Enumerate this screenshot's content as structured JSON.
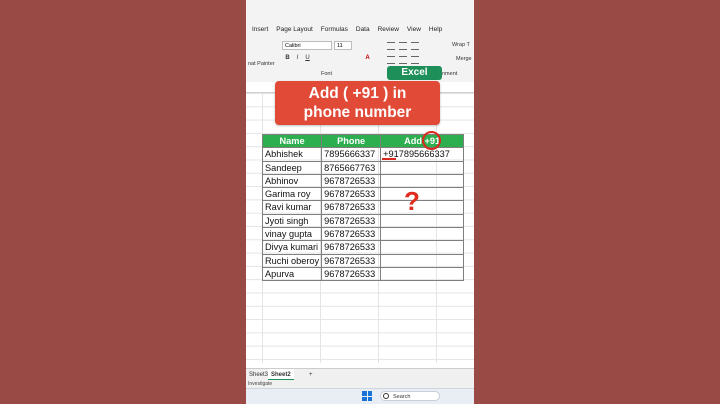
{
  "ribbon": {
    "menu": [
      "Insert",
      "Page Layout",
      "Formulas",
      "Data",
      "Review",
      "View",
      "Help"
    ],
    "font_name": "Calibri",
    "font_size": "11",
    "bold": "B",
    "italic": "I",
    "underline": "U",
    "font_color_glyph": "A",
    "group_font": "Font",
    "painter": "nat Painter",
    "wrap": "Wrap T",
    "merge": "Merge",
    "alignment_fragment": "nment"
  },
  "badge": {
    "label": "Excel"
  },
  "banner": {
    "line1": "Add ( +91 ) in",
    "line2": "phone number"
  },
  "table": {
    "headers": [
      "Name",
      "Phone",
      "Add +91"
    ],
    "rows": [
      {
        "name": "Abhishek",
        "phone": "7895666337",
        "add": "+917895666337"
      },
      {
        "name": "Sandeep",
        "phone": "8765667763",
        "add": ""
      },
      {
        "name": "Abhinov",
        "phone": "9678726533",
        "add": ""
      },
      {
        "name": "Garima roy",
        "phone": "9678726533",
        "add": ""
      },
      {
        "name": "Ravi kumar",
        "phone": "9678726533",
        "add": ""
      },
      {
        "name": "Jyoti singh",
        "phone": "9678726533",
        "add": ""
      },
      {
        "name": "vinay gupta",
        "phone": "9678726533",
        "add": ""
      },
      {
        "name": "Divya kumari",
        "phone": "9678726533",
        "add": ""
      },
      {
        "name": "Ruchi oberoy",
        "phone": "9678726533",
        "add": ""
      },
      {
        "name": "Apurva",
        "phone": "9678726533",
        "add": ""
      }
    ]
  },
  "annotation": {
    "question": "?"
  },
  "sheets": {
    "tab1": "Sheet3",
    "tab2": "Sheet2",
    "add": "+"
  },
  "status": {
    "text": "Investigate"
  },
  "taskbar": {
    "search": "Search"
  },
  "colors": {
    "header_green": "#2dae4f",
    "banner_red": "#e24a38",
    "accent_red": "#d9281e",
    "excel_green": "#1f8f5a",
    "background": "#9a4a44"
  }
}
